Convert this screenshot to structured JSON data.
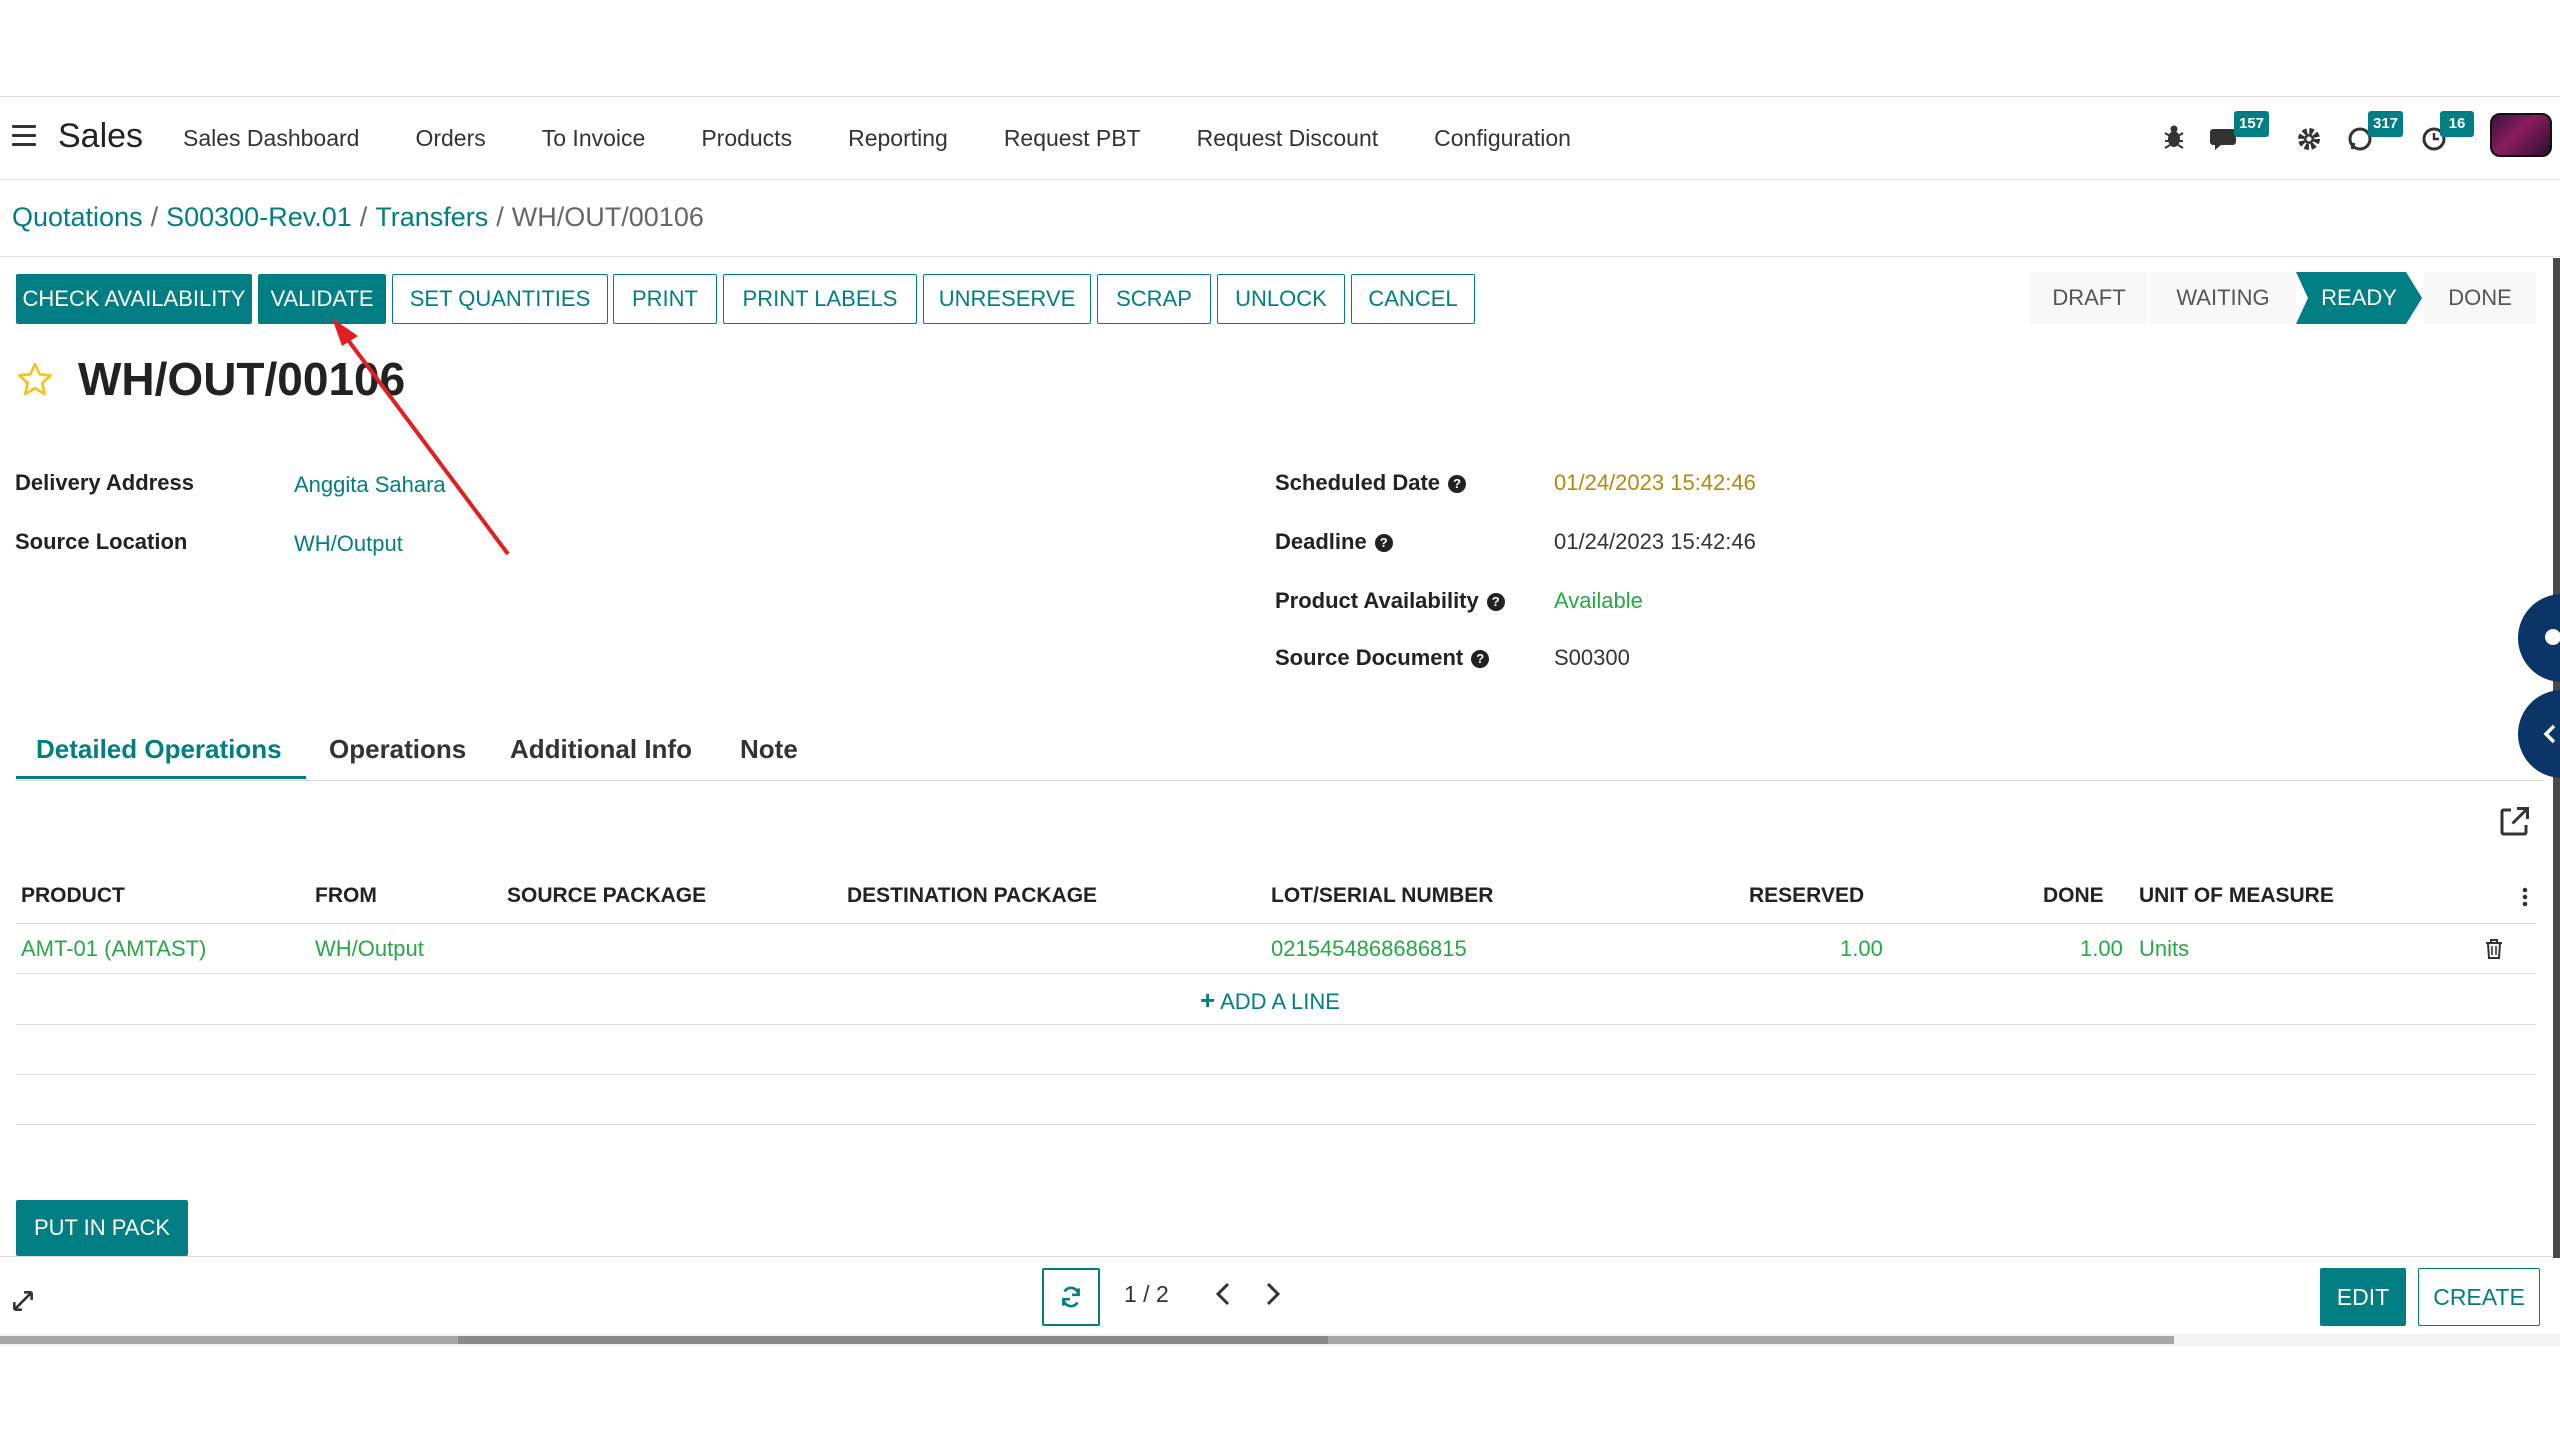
{
  "app": {
    "title": "Sales"
  },
  "menu": [
    "Sales Dashboard",
    "Orders",
    "To Invoice",
    "Products",
    "Reporting",
    "Request PBT",
    "Request Discount",
    "Configuration"
  ],
  "systray": {
    "messages_count": "157",
    "discuss_count": "317",
    "activities_count": "16",
    "icons": [
      "bug-icon",
      "chat-icon",
      "gear-icon",
      "whatsapp-icon",
      "clock-icon"
    ]
  },
  "breadcrumb": {
    "items": [
      "Quotations",
      "S00300-Rev.01",
      "Transfers"
    ],
    "current": "WH/OUT/00106"
  },
  "actions": [
    "CHECK AVAILABILITY",
    "VALIDATE",
    "SET QUANTITIES",
    "PRINT",
    "PRINT LABELS",
    "UNRESERVE",
    "SCRAP",
    "UNLOCK",
    "CANCEL"
  ],
  "status": {
    "stages": [
      "DRAFT",
      "WAITING",
      "READY",
      "DONE"
    ],
    "active": "READY"
  },
  "record": {
    "title": "WH/OUT/00106"
  },
  "fields": {
    "delivery_address": {
      "label": "Delivery Address",
      "value": "Anggita Sahara"
    },
    "source_location": {
      "label": "Source Location",
      "value": "WH/Output"
    },
    "scheduled_date": {
      "label": "Scheduled Date",
      "value": "01/24/2023 15:42:46"
    },
    "deadline": {
      "label": "Deadline",
      "value": "01/24/2023 15:42:46"
    },
    "product_availability": {
      "label": "Product Availability",
      "value": "Available"
    },
    "source_document": {
      "label": "Source Document",
      "value": "S00300"
    }
  },
  "tabs": [
    "Detailed Operations",
    "Operations",
    "Additional Info",
    "Note"
  ],
  "table": {
    "columns": [
      "PRODUCT",
      "FROM",
      "SOURCE PACKAGE",
      "DESTINATION PACKAGE",
      "LOT/SERIAL NUMBER",
      "RESERVED",
      "DONE",
      "UNIT OF MEASURE"
    ],
    "rows": [
      {
        "product": "AMT-01 (AMTAST)",
        "from": "WH/Output",
        "source_package": "",
        "destination_package": "",
        "lot": "0215454868686815",
        "reserved": "1.00",
        "done": "1.00",
        "uom": "Units"
      }
    ],
    "add_line": "ADD A LINE"
  },
  "put_in_pack": "PUT IN PACK",
  "pager": {
    "text": "1 / 2"
  },
  "bottom_buttons": {
    "edit": "EDIT",
    "create": "CREATE"
  },
  "colors": {
    "primary": "#017e84",
    "link": "#017e84",
    "date_warning": "#b8860b",
    "available": "#28a745",
    "arrow": "#e02020"
  }
}
